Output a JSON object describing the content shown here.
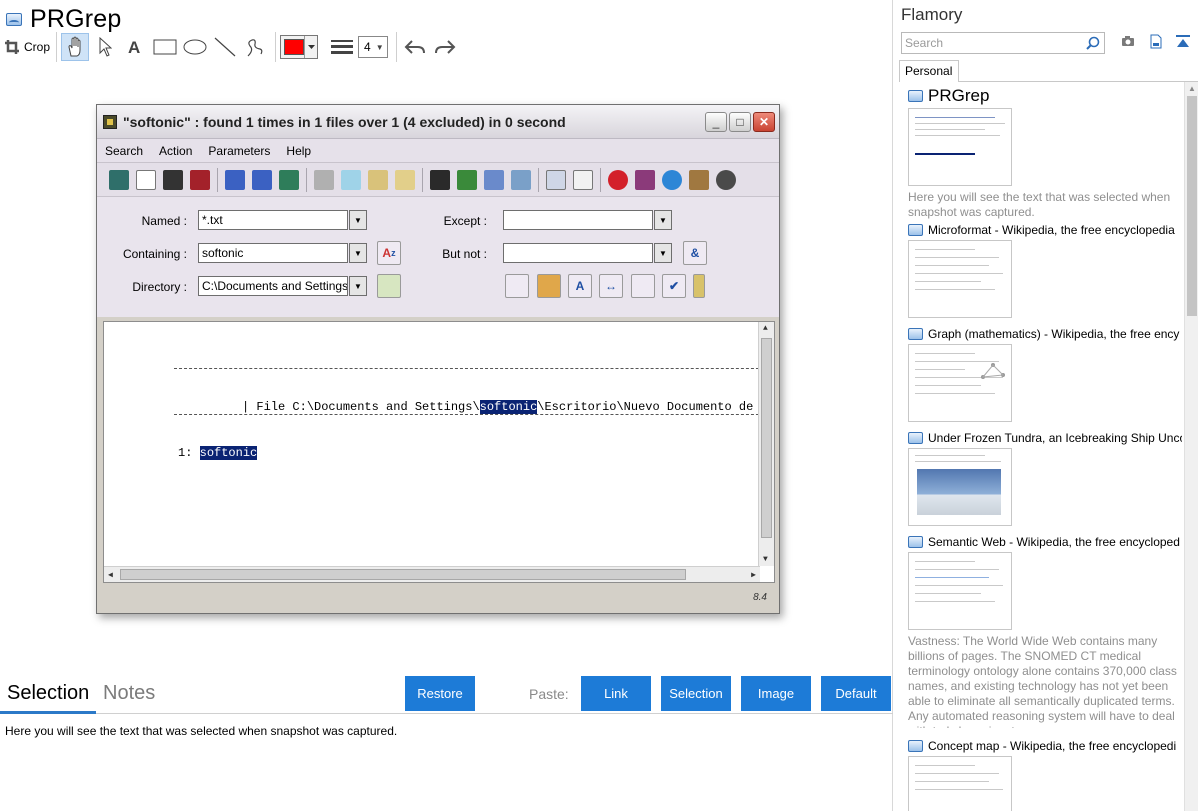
{
  "app": {
    "title": "PRGrep"
  },
  "toolbar": {
    "crop_label": "Crop",
    "line_width": "4",
    "stroke_color": "#ff0000"
  },
  "screenshot": {
    "window_title": "\"softonic\" : found 1 times in 1 files over 1 (4 excluded) in 0 second",
    "menu": [
      "Search",
      "Action",
      "Parameters",
      "Help"
    ],
    "form": {
      "named_label": "Named :",
      "named_value": "*.txt",
      "except_label": "Except :",
      "except_value": "",
      "containing_label": "Containing :",
      "containing_value": "softonic",
      "butnot_label": "But not :",
      "butnot_value": "",
      "directory_label": "Directory :",
      "directory_value": "C:\\Documents and Settings"
    },
    "result": {
      "file_prefix": "| File C:\\Documents and Settings\\",
      "file_match": "softonic",
      "file_suffix": "\\Escritorio\\Nuevo Documento de text",
      "line_prefix": "1: ",
      "line_match": "softonic"
    },
    "version": "8.4"
  },
  "bottom": {
    "tab_selection": "Selection",
    "tab_notes": "Notes",
    "restore_button": "Restore",
    "paste_label": "Paste:",
    "paste_link": "Link",
    "paste_selection": "Selection",
    "paste_image": "Image",
    "paste_default": "Default",
    "selection_text": "Here you will see the text that was selected when snapshot was captured."
  },
  "flamory": {
    "title": "Flamory",
    "search_placeholder": "Search",
    "tab_personal": "Personal",
    "items": [
      {
        "title": "PRGrep",
        "desc": "Here you will see the text that was selected when snapshot was captured."
      },
      {
        "title": "Microformat - Wikipedia, the free encyclopedia",
        "desc": ""
      },
      {
        "title": "Graph (mathematics) - Wikipedia, the free ency",
        "desc": ""
      },
      {
        "title": "Under Frozen Tundra, an Icebreaking Ship Unco",
        "desc": ""
      },
      {
        "title": "Semantic Web - Wikipedia, the free encycloped",
        "desc": "Vastness: The World Wide Web contains many billions of pages. The SNOMED CT medical terminology ontology alone contains 370,000 class names, and existing technology has not yet been able to eliminate all semantically duplicated terms. Any automated reasoning system will have to deal with truly huge inputs."
      },
      {
        "title": "Concept map - Wikipedia, the free encyclopedi",
        "desc": ""
      }
    ]
  },
  "colors": {
    "accent": "#1d7bd7",
    "highlight": "#0a2373",
    "tab_underline": "#2b79c8"
  }
}
